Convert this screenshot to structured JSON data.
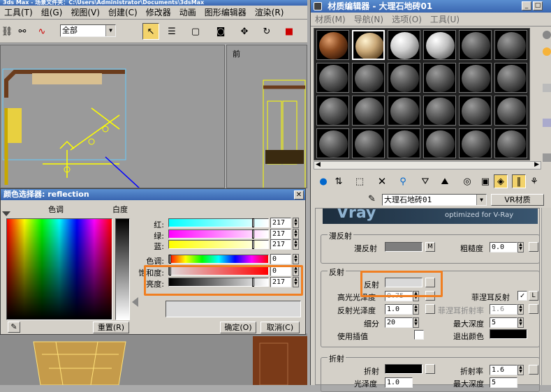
{
  "main_window": {
    "title": "3ds Max - 场景文件夹：C:\\Users\\Administrator\\Documents\\3dsMax",
    "menu": [
      "工具(T)",
      "组(G)",
      "视图(V)",
      "创建(C)",
      "修改器",
      "动画",
      "图形编辑器",
      "渲染(R)"
    ],
    "selection_filter": "全部",
    "viewport_front_label": "前"
  },
  "color_selector": {
    "title": "颜色选择器: reflection",
    "hue_label": "色调",
    "whiteness_label": "白度",
    "channels": [
      {
        "label": "红:",
        "value": "217"
      },
      {
        "label": "绿:",
        "value": "217"
      },
      {
        "label": "蓝:",
        "value": "217"
      },
      {
        "label": "色调:",
        "value": "0"
      },
      {
        "label": "饱和度:",
        "value": "0"
      },
      {
        "label": "亮度:",
        "value": "217"
      }
    ],
    "reset_button": "重置(R)",
    "ok_button": "确定(O)",
    "cancel_button": "取消(C)",
    "current_color": "#d9d9d9"
  },
  "material_editor": {
    "title": "材质编辑器 - 大理石地砖01",
    "menu": [
      "材质(M)",
      "导航(N)",
      "选项(O)",
      "工具(U)"
    ],
    "material_name": "大理石地砖01",
    "material_type": "VR材质",
    "banner_text": "optimized for V-Ray",
    "diffuse": {
      "section": "漫反射",
      "diffuse_label": "漫反射",
      "diffuse_map": "M",
      "roughness_label": "粗糙度",
      "roughness_value": "0.0"
    },
    "reflection": {
      "section": "反射",
      "reflect_label": "反射",
      "hilight_gloss_label": "高光光泽度",
      "hilight_gloss_value": "0.75",
      "refl_gloss_label": "反射光泽度",
      "refl_gloss_value": "1.0",
      "subdivs_label": "细分",
      "subdivs_value": "20",
      "interp_label": "使用插值",
      "fresnel_label": "菲涅耳反射",
      "fresnel_checked": "✓",
      "fresnel_lock": "L",
      "fresnel_ior_label": "菲涅耳折射率",
      "fresnel_ior_value": "1.6",
      "max_depth_label": "最大深度",
      "max_depth_value": "5",
      "exit_color_label": "退出颜色"
    },
    "refraction": {
      "section": "折射",
      "refract_label": "折射",
      "ior_label": "折射率",
      "ior_value": "1.6",
      "gloss_label": "光泽度",
      "gloss_value": "1.0",
      "max_depth_label": "最大深度",
      "max_depth_value": "5"
    }
  }
}
